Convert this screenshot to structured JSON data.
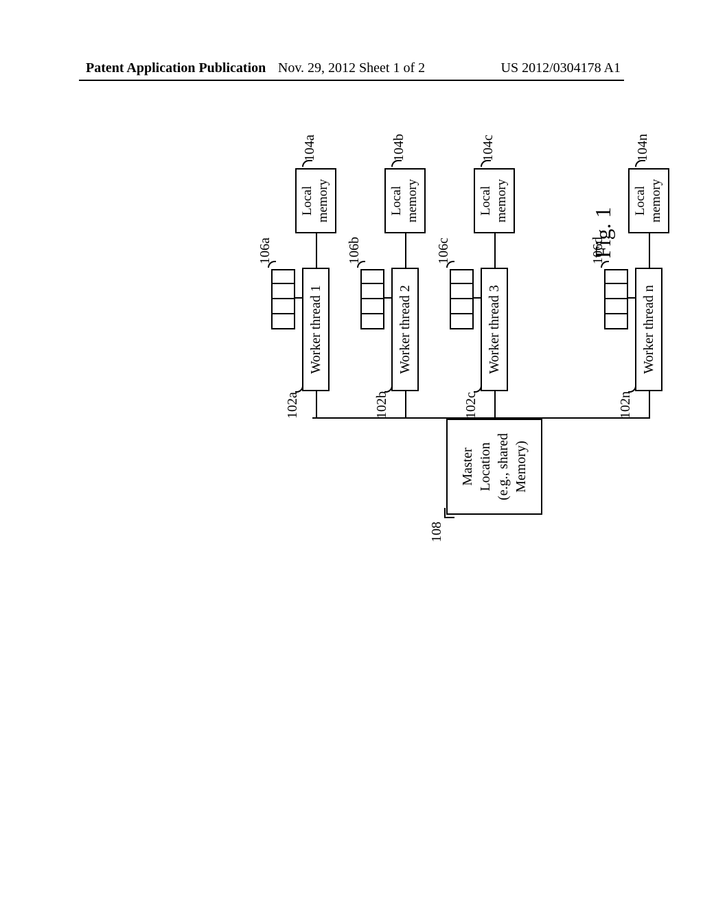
{
  "header": {
    "left": "Patent Application Publication",
    "center": "Nov. 29, 2012  Sheet 1 of 2",
    "right": "US 2012/0304178 A1"
  },
  "diagram": {
    "master": {
      "text": "Master\nLocation\n(e.g., shared\nMemory)",
      "label": "108"
    },
    "workers": [
      {
        "name": "Worker thread 1",
        "worker_label": "102a",
        "queue_label": "106a",
        "memory_text": "Local\nmemory",
        "memory_label": "104a"
      },
      {
        "name": "Worker thread 2",
        "worker_label": "102b",
        "queue_label": "106b",
        "memory_text": "Local\nmemory",
        "memory_label": "104b"
      },
      {
        "name": "Worker thread 3",
        "worker_label": "102c",
        "queue_label": "106c",
        "memory_text": "Local\nmemory",
        "memory_label": "104c"
      },
      {
        "name": "Worker thread n",
        "worker_label": "102n",
        "queue_label": "106d",
        "memory_text": "Local\nmemory",
        "memory_label": "104n"
      }
    ],
    "figure_label": "Fig. 1"
  }
}
